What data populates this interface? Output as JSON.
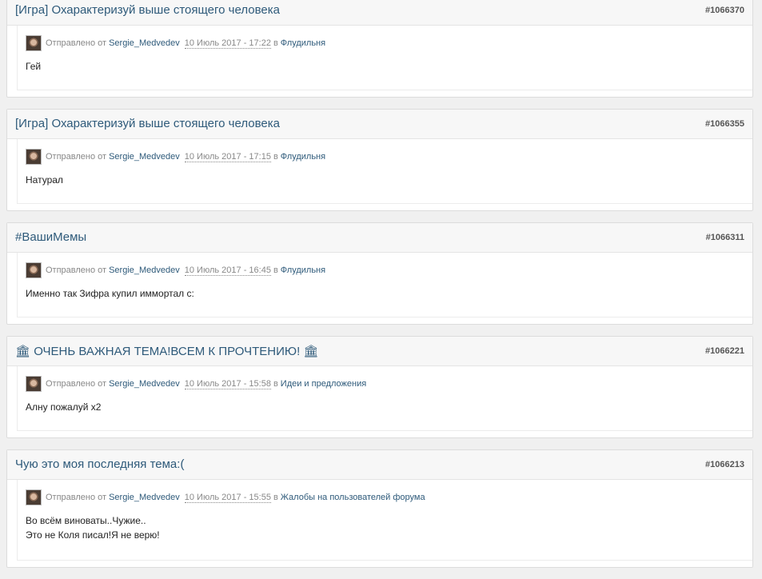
{
  "common": {
    "sent_by": "Отправлено от",
    "in": "в",
    "author": "Sergie_Medvedev"
  },
  "posts": [
    {
      "title": "[Игра] Охарактеризуй выше стоящего человека",
      "number": "#1066370",
      "date": "10 Июль 2017 - 17:22",
      "forum": "Флудильня",
      "lines": [
        "Гей"
      ]
    },
    {
      "title": "[Игра] Охарактеризуй выше стоящего человека",
      "number": "#1066355",
      "date": "10 Июль 2017 - 17:15",
      "forum": "Флудильня",
      "lines": [
        "Натурал"
      ]
    },
    {
      "title": "#ВашиМемы",
      "number": "#1066311",
      "date": "10 Июль 2017 - 16:45",
      "forum": "Флудильня",
      "lines": [
        "Именно так Зифра купил иммортал с:"
      ]
    },
    {
      "title": "🏛 ОЧЕНЬ ВАЖНАЯ ТЕМА!ВСЕМ К ПРОЧТЕНИЮ! 🏛",
      "number": "#1066221",
      "date": "10 Июль 2017 - 15:58",
      "forum": "Идеи и предложения",
      "lines": [
        "Алну пожалуй х2"
      ]
    },
    {
      "title": "Чую это моя последняя тема:(",
      "number": "#1066213",
      "date": "10 Июль 2017 - 15:55",
      "forum": "Жалобы на пользователей форума",
      "lines": [
        "Во всём виноваты..Чужие..",
        "Это не Коля писал!Я не верю!"
      ]
    }
  ]
}
